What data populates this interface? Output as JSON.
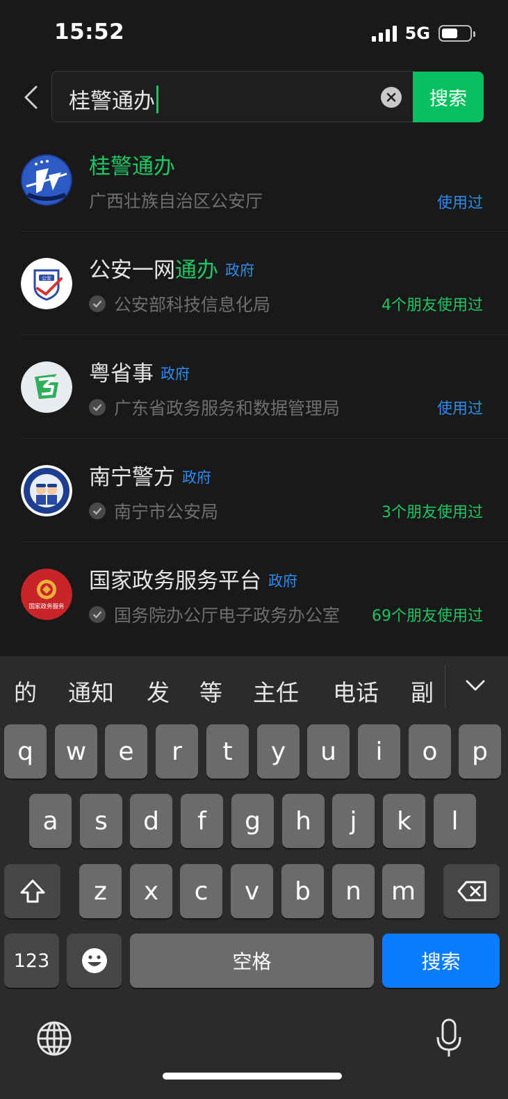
{
  "status": {
    "time": "15:52",
    "network": "5G"
  },
  "search": {
    "query": "桂警通办",
    "button_label": "搜索"
  },
  "results": [
    {
      "title_prefix": "",
      "title_highlight": "桂警通办",
      "tag": "",
      "subtitle": "广西壮族自治区公安厅",
      "verified": false,
      "used_label": "使用过",
      "used_color": "blue"
    },
    {
      "title_prefix": "公安一网",
      "title_highlight": "通办",
      "tag": "政府",
      "subtitle": "公安部科技信息化局",
      "verified": true,
      "used_label": "4个朋友使用过",
      "used_color": "green"
    },
    {
      "title_prefix": "粤省事",
      "title_highlight": "",
      "tag": "政府",
      "subtitle": "广东省政务服务和数据管理局",
      "verified": true,
      "used_label": "使用过",
      "used_color": "blue"
    },
    {
      "title_prefix": "南宁警方",
      "title_highlight": "",
      "tag": "政府",
      "subtitle": "南宁市公安局",
      "verified": true,
      "used_label": "3个朋友使用过",
      "used_color": "green"
    },
    {
      "title_prefix": "国家政务服务平台",
      "title_highlight": "",
      "tag": "政府",
      "subtitle": "国务院办公厅电子政务办公室",
      "verified": true,
      "used_label": "69个朋友使用过",
      "used_color": "green"
    }
  ],
  "logos": {
    "item5_text": "国家政务服务",
    "item2_text": "公安"
  },
  "keyboard": {
    "candidates": [
      "的",
      "通知",
      "发",
      "等",
      "主任",
      "电话",
      "副"
    ],
    "row1": [
      "q",
      "w",
      "e",
      "r",
      "t",
      "y",
      "u",
      "i",
      "o",
      "p"
    ],
    "row2": [
      "a",
      "s",
      "d",
      "f",
      "g",
      "h",
      "j",
      "k",
      "l"
    ],
    "row3": [
      "z",
      "x",
      "c",
      "v",
      "b",
      "n",
      "m"
    ],
    "num_label": "123",
    "space_label": "空格",
    "search_label": "搜索"
  },
  "colors": {
    "accent_green": "#07c160",
    "highlight_green": "#1fc564",
    "tag_blue": "#2d8cf0",
    "key_blue": "#0a7cff"
  }
}
